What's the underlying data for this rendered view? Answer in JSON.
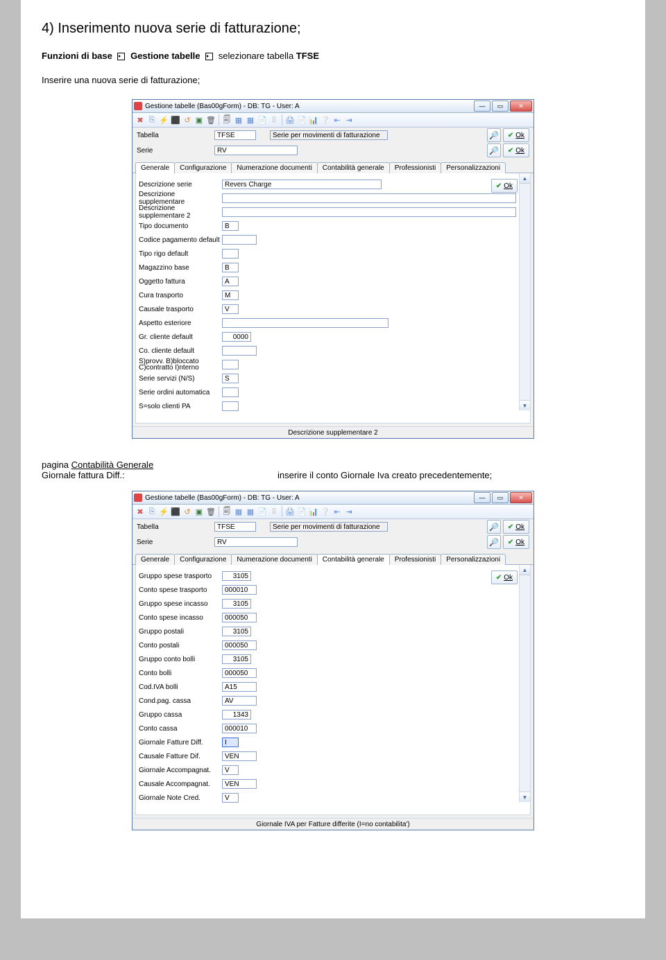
{
  "doc": {
    "step_title": "4) Inserimento nuova serie di fatturazione;",
    "breadcrumb_1": "Funzioni di base",
    "breadcrumb_2": "Gestione tabelle",
    "breadcrumb_3a": "selezionare tabella ",
    "breadcrumb_3b": "TFSE",
    "instr1": "Inserire una nuova serie di fatturazione;",
    "section2_label_pre": "pagina ",
    "section2_label_und": "Contabilità Generale",
    "section2_sub_label": "Giornale fattura Diff.:",
    "section2_sub_text": "inserire il conto Giornale Iva creato precedentemente;"
  },
  "win": {
    "title": "Gestione tabelle (Bas00gForm) - DB: TG - User: A",
    "ok_label": "Ok",
    "tabella_label": "Tabella",
    "tabella_value": "TFSE",
    "tabella_desc": "Serie per movimenti di fatturazione",
    "serie_label": "Serie",
    "serie_value": "RV",
    "tabs": {
      "generale": "Generale",
      "configurazione": "Configurazione",
      "numerazione": "Numerazione documenti",
      "contabilita": "Contabilità generale",
      "professionisti": "Professionisti",
      "personalizzazioni": "Personalizzazioni"
    }
  },
  "shot1": {
    "status": "Descrizione supplementare 2",
    "rows": {
      "descrizione_serie": {
        "label": "Descrizione serie",
        "value": "Revers Charge"
      },
      "descrizione_supp": {
        "label": "Descrizione supplementare",
        "value": ""
      },
      "descrizione_supp2": {
        "label": "Descrizione supplementare 2",
        "value": ""
      },
      "tipo_documento": {
        "label": "Tipo documento",
        "value": "B"
      },
      "codice_pagamento": {
        "label": "Codice pagamento default",
        "value": ""
      },
      "tipo_rigo": {
        "label": "Tipo rigo default",
        "value": ""
      },
      "magazzino": {
        "label": "Magazzino base",
        "value": "B"
      },
      "oggetto": {
        "label": "Oggetto fattura",
        "value": "A"
      },
      "cura_trasporto": {
        "label": "Cura trasporto",
        "value": "M"
      },
      "causale_trasporto": {
        "label": "Causale trasporto",
        "value": "V"
      },
      "aspetto": {
        "label": "Aspetto esteriore",
        "value": ""
      },
      "gr_cliente": {
        "label": "Gr. cliente default",
        "value": "0000"
      },
      "co_cliente": {
        "label": "Co. cliente default",
        "value": ""
      },
      "sprovv": {
        "label": "S)provv. B)bloccato C)contratto I)nterno",
        "value": ""
      },
      "serie_servizi": {
        "label": "Serie servizi (N/S)",
        "value": "S"
      },
      "serie_ordini": {
        "label": "Serie ordini automatica",
        "value": ""
      },
      "solo_pa": {
        "label": "S=solo clienti PA",
        "value": ""
      }
    }
  },
  "shot2": {
    "status": "Giornale IVA per Fatture differite (I=no contabilita')",
    "rows": {
      "gruppo_spese_trasporto": {
        "label": "Gruppo spese trasporto",
        "value": "3105"
      },
      "conto_spese_trasporto": {
        "label": "Conto spese trasporto",
        "value": "000010"
      },
      "gruppo_spese_incasso": {
        "label": "Gruppo spese incasso",
        "value": "3105"
      },
      "conto_spese_incasso": {
        "label": "Conto spese incasso",
        "value": "000050"
      },
      "gruppo_postali": {
        "label": "Gruppo postali",
        "value": "3105"
      },
      "conto_postali": {
        "label": "Conto postali",
        "value": "000050"
      },
      "gruppo_conto_bolli": {
        "label": "Gruppo conto bolli",
        "value": "3105"
      },
      "conto_bolli": {
        "label": "Conto bolli",
        "value": "000050"
      },
      "cod_iva_bolli": {
        "label": "Cod.IVA bolli",
        "value": "A15"
      },
      "cond_pag_cassa": {
        "label": "Cond.pag. cassa",
        "value": "AV"
      },
      "gruppo_cassa": {
        "label": "Gruppo cassa",
        "value": "1343"
      },
      "conto_cassa": {
        "label": "Conto cassa",
        "value": "000010"
      },
      "giornale_fatture_diff": {
        "label": "Giornale Fatture Diff.",
        "value": "I"
      },
      "causale_fatture_dif": {
        "label": "Causale Fatture Dif.",
        "value": "VEN"
      },
      "giornale_accompagnat": {
        "label": "Giornale Accompagnat.",
        "value": "V"
      },
      "causale_accompagnat": {
        "label": "Causale Accompagnat.",
        "value": "VEN"
      },
      "giornale_note_cred": {
        "label": "Giornale Note Cred.",
        "value": "V"
      }
    }
  },
  "toolbar_icons": [
    "✖",
    "⎘",
    "⚡",
    "⬛",
    "↺",
    "▣",
    "🗑",
    "🗐",
    "▦",
    "▦",
    "📄",
    "⌷",
    "🖨",
    "📄",
    "📊",
    "❔",
    "⇤",
    "⇥"
  ],
  "toolbar_icon_colors": [
    "#d9534f",
    "#5f8dd3",
    "#c28d2a",
    "#5e5e5e",
    "#d28f2e",
    "#3b7a3b",
    "#555",
    "#555",
    "#5f8dd3",
    "#5f8dd3",
    "#999",
    "#999",
    "#5f8dd3",
    "#b48a3d",
    "#5f8dd3",
    "#3b7a3b",
    "#5f8dd3",
    "#5f8dd3"
  ]
}
